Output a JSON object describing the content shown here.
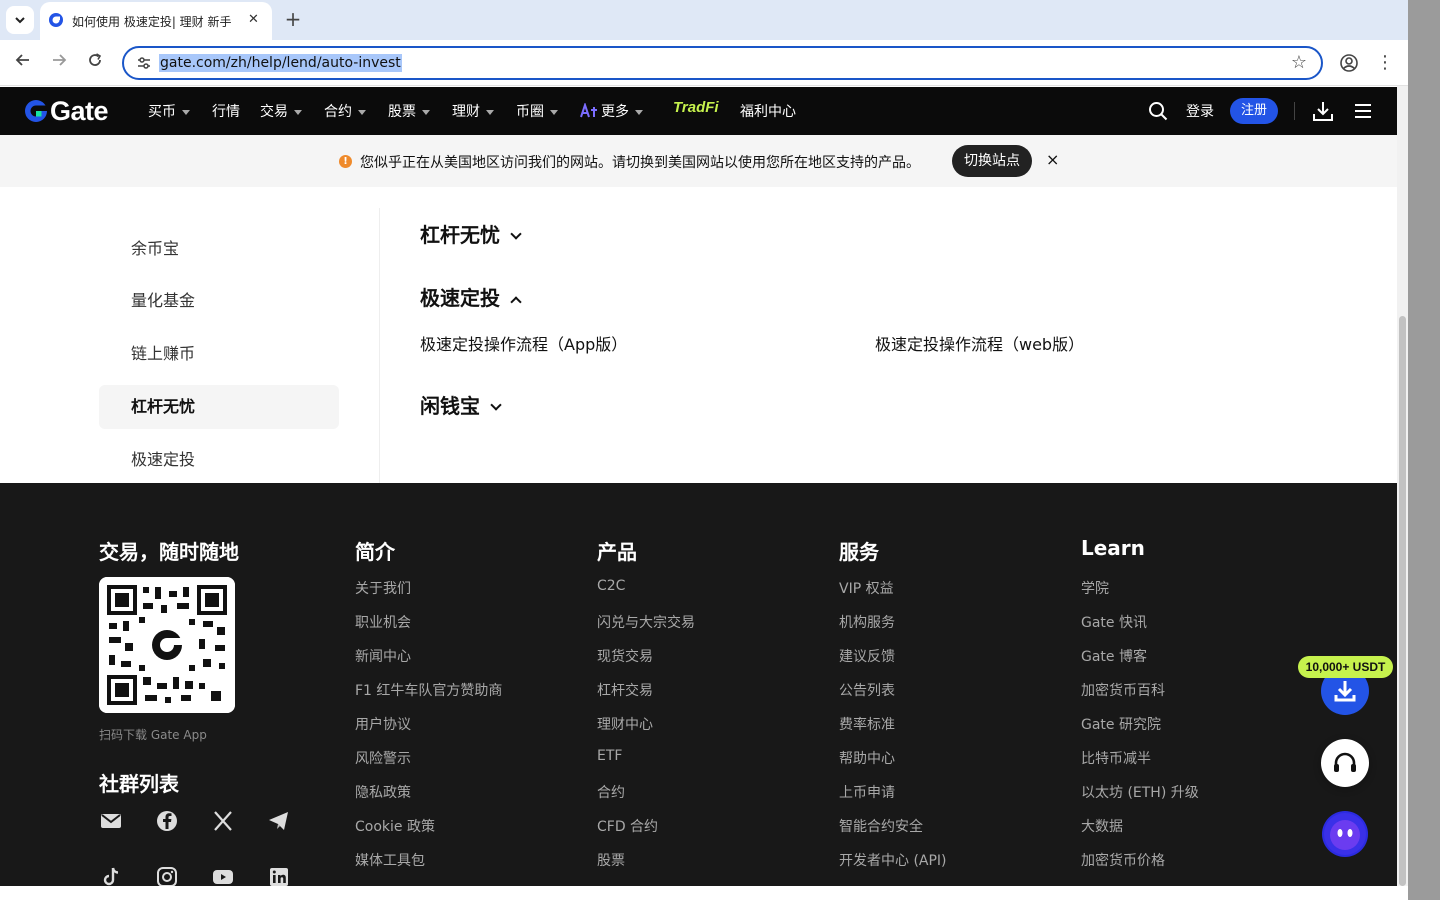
{
  "browser": {
    "tab_title": "如何使用 极速定投| 理财 新手",
    "url": "gate.com/zh/help/lend/auto-invest",
    "new_tab_label": "+",
    "tab_close_label": "✕"
  },
  "header": {
    "logo_text": "Gate",
    "nav": [
      {
        "label": "买币",
        "has_dropdown": true
      },
      {
        "label": "行情",
        "has_dropdown": false
      },
      {
        "label": "交易",
        "has_dropdown": true
      },
      {
        "label": "合约",
        "has_dropdown": true
      },
      {
        "label": "股票",
        "has_dropdown": true
      },
      {
        "label": "理财",
        "has_dropdown": true
      },
      {
        "label": "币圈",
        "has_dropdown": true
      },
      {
        "label": "更多",
        "has_dropdown": true
      },
      {
        "label": "TradFi",
        "has_dropdown": false
      },
      {
        "label": "福利中心",
        "has_dropdown": false
      }
    ],
    "login_label": "登录",
    "register_label": "注册"
  },
  "banner": {
    "message": "您似乎正在从美国地区访问我们的网站。请切换到美国网站以使用您所在地区支持的产品。",
    "switch_label": "切换站点",
    "close_label": "×"
  },
  "sidebar": {
    "items": [
      {
        "label": "余币宝",
        "active": false
      },
      {
        "label": "量化基金",
        "active": false
      },
      {
        "label": "链上赚币",
        "active": false
      },
      {
        "label": "杠杆无忧",
        "active": true
      },
      {
        "label": "极速定投",
        "active": false
      }
    ]
  },
  "main": {
    "sections": [
      {
        "title": "杠杆无忧",
        "expanded": false
      },
      {
        "title": "极速定投",
        "expanded": true
      },
      {
        "title": "闲钱宝",
        "expanded": false
      }
    ],
    "articles": [
      "极速定投操作流程（App版）",
      "极速定投操作流程（web版）"
    ]
  },
  "footer": {
    "app_title": "交易，随时随地",
    "qr_caption": "扫码下载 Gate App",
    "community_title": "社群列表",
    "columns": [
      {
        "heading": "简介",
        "links": [
          "关于我们",
          "职业机会",
          "新闻中心",
          "F1 红牛车队官方赞助商",
          "用户协议",
          "风险警示",
          "隐私政策",
          "Cookie 政策",
          "媒体工具包"
        ]
      },
      {
        "heading": "产品",
        "links": [
          "C2C",
          "闪兑与大宗交易",
          "现货交易",
          "杠杆交易",
          "理财中心",
          "ETF",
          "合约",
          "CFD 合约",
          "股票"
        ]
      },
      {
        "heading": "服务",
        "links": [
          "VIP 权益",
          "机构服务",
          "建议反馈",
          "公告列表",
          "费率标准",
          "帮助中心",
          "上币申请",
          "智能合约安全",
          "开发者中心 (API)"
        ]
      },
      {
        "heading": "Learn",
        "links": [
          "学院",
          "Gate 快讯",
          "Gate 博客",
          "加密货币百科",
          "Gate 研究院",
          "比特币减半",
          "以太坊 (ETH) 升级",
          "大数据",
          "加密货币价格"
        ]
      }
    ],
    "socials": [
      "email-icon",
      "facebook-icon",
      "x-icon",
      "telegram-icon",
      "tiktok-icon",
      "instagram-icon",
      "youtube-icon",
      "linkedin-icon"
    ]
  },
  "floating": {
    "promo_badge": "10,000+ USDT"
  },
  "colors": {
    "header_bg": "#0b0b0b",
    "accent_blue": "#2354e6",
    "promo_green": "#c6f24d",
    "footer_bg": "#181818"
  }
}
